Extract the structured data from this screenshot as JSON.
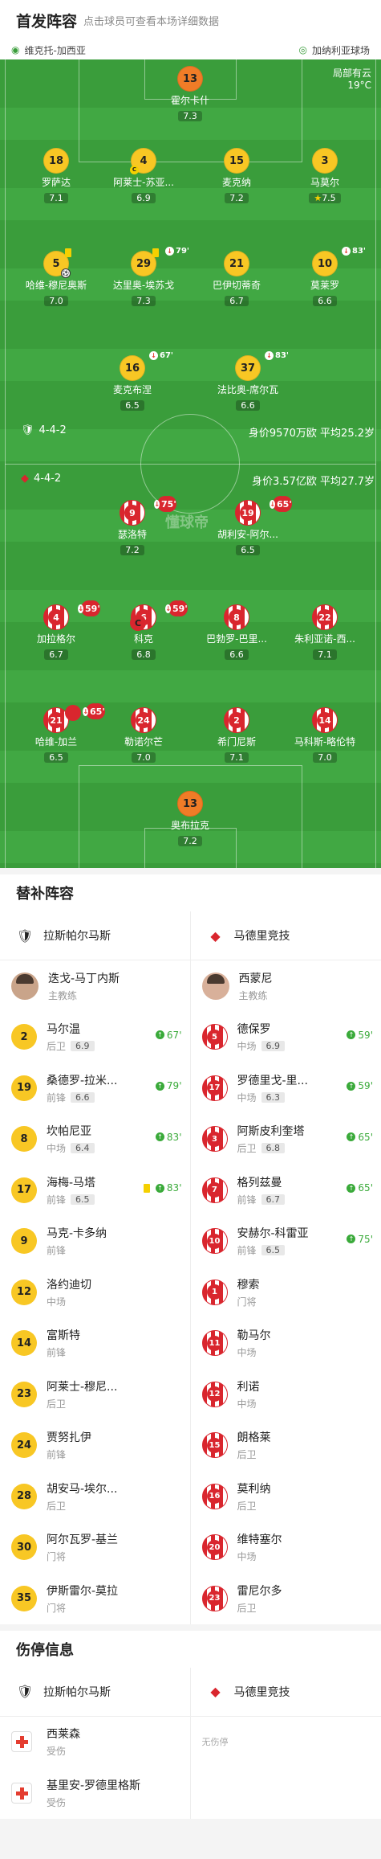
{
  "header": {
    "title": "首发阵容",
    "subtitle": "点击球员可查看本场详细数据"
  },
  "venue": {
    "left": "维克托-加西亚",
    "right": "加纳利亚球场"
  },
  "weather": {
    "line1": "局部有云",
    "line2": "19°C"
  },
  "watermark": "懂球帝",
  "home_team": {
    "formation": "4-4-2",
    "value": "身价9570万欧",
    "age": "平均25.2岁"
  },
  "away_team": {
    "formation": "4-4-2",
    "value": "身价3.57亿欧",
    "age": "平均27.7岁"
  },
  "home_players": [
    {
      "num": "13",
      "name": "霍尔卡什",
      "rating": "7.3"
    },
    {
      "num": "18",
      "name": "罗萨达",
      "rating": "7.1"
    },
    {
      "num": "4",
      "name": "阿莱士-苏亚...",
      "rating": "6.9"
    },
    {
      "num": "15",
      "name": "麦克纳",
      "rating": "7.2"
    },
    {
      "num": "3",
      "name": "马莫尔",
      "rating": "7.5"
    },
    {
      "num": "5",
      "name": "哈维-穆尼奥斯",
      "rating": "7.0"
    },
    {
      "num": "29",
      "name": "达里奥-埃苏戈",
      "rating": "7.3",
      "sub": "79'"
    },
    {
      "num": "21",
      "name": "巴伊切蒂奇",
      "rating": "6.7"
    },
    {
      "num": "10",
      "name": "莫莱罗",
      "rating": "6.6",
      "sub": "83'"
    },
    {
      "num": "16",
      "name": "麦克布涅",
      "rating": "6.5",
      "sub": "67'"
    },
    {
      "num": "37",
      "name": "法比奥-席尔瓦",
      "rating": "6.6",
      "sub": "83'"
    }
  ],
  "away_players": [
    {
      "num": "9",
      "name": "瑟洛特",
      "rating": "7.2",
      "sub": "75'"
    },
    {
      "num": "19",
      "name": "胡利安-阿尔...",
      "rating": "6.5",
      "sub": "65'"
    },
    {
      "num": "4",
      "name": "加拉格尔",
      "rating": "6.7",
      "sub": "59'"
    },
    {
      "num": "6",
      "name": "科克",
      "rating": "6.8",
      "sub": "59'"
    },
    {
      "num": "8",
      "name": "巴勃罗-巴里...",
      "rating": "6.6"
    },
    {
      "num": "22",
      "name": "朱利亚诺-西...",
      "rating": "7.1"
    },
    {
      "num": "21",
      "name": "哈维-加兰",
      "rating": "6.5",
      "sub": "65'"
    },
    {
      "num": "24",
      "name": "勒诺尔芒",
      "rating": "7.0"
    },
    {
      "num": "2",
      "name": "希门尼斯",
      "rating": "7.1"
    },
    {
      "num": "14",
      "name": "马科斯-略伦特",
      "rating": "7.0"
    },
    {
      "num": "13",
      "name": "奥布拉克",
      "rating": "7.2"
    }
  ],
  "subs_title": "替补阵容",
  "home_name": "拉斯帕尔马斯",
  "away_name": "马德里竞技",
  "home_coach": {
    "name": "迭戈-马丁内斯",
    "role": "主教练"
  },
  "away_coach": {
    "name": "西蒙尼",
    "role": "主教练"
  },
  "home_subs": [
    {
      "num": "2",
      "name": "马尔温",
      "pos": "后卫",
      "rating": "6.9",
      "min": "67'"
    },
    {
      "num": "19",
      "name": "桑德罗-拉米...",
      "pos": "前锋",
      "rating": "6.6",
      "min": "79'"
    },
    {
      "num": "8",
      "name": "坎帕尼亚",
      "pos": "中场",
      "rating": "6.4",
      "min": "83'"
    },
    {
      "num": "17",
      "name": "海梅-马塔",
      "pos": "前锋",
      "rating": "6.5",
      "min": "83'",
      "yellow": true
    },
    {
      "num": "9",
      "name": "马克-卡多纳",
      "pos": "前锋"
    },
    {
      "num": "12",
      "name": "洛约迪切",
      "pos": "中场"
    },
    {
      "num": "14",
      "name": "富斯特",
      "pos": "前锋"
    },
    {
      "num": "23",
      "name": "阿莱士-穆尼...",
      "pos": "后卫"
    },
    {
      "num": "24",
      "name": "贾努扎伊",
      "pos": "前锋"
    },
    {
      "num": "28",
      "name": "胡安马-埃尔...",
      "pos": "后卫"
    },
    {
      "num": "30",
      "name": "阿尔瓦罗-基兰",
      "pos": "门将"
    },
    {
      "num": "35",
      "name": "伊斯雷尔-莫拉",
      "pos": "门将"
    }
  ],
  "away_subs": [
    {
      "num": "5",
      "name": "德保罗",
      "pos": "中场",
      "rating": "6.9",
      "min": "59'"
    },
    {
      "num": "17",
      "name": "罗德里戈-里...",
      "pos": "中场",
      "rating": "6.3",
      "min": "59'"
    },
    {
      "num": "3",
      "name": "阿斯皮利奎塔",
      "pos": "后卫",
      "rating": "6.8",
      "min": "65'"
    },
    {
      "num": "7",
      "name": "格列兹曼",
      "pos": "前锋",
      "rating": "6.7",
      "min": "65'"
    },
    {
      "num": "10",
      "name": "安赫尔-科雷亚",
      "pos": "前锋",
      "rating": "6.5",
      "min": "75'"
    },
    {
      "num": "1",
      "name": "穆索",
      "pos": "门将"
    },
    {
      "num": "11",
      "name": "勒马尔",
      "pos": "中场"
    },
    {
      "num": "12",
      "name": "利诺",
      "pos": "中场"
    },
    {
      "num": "15",
      "name": "朗格莱",
      "pos": "后卫"
    },
    {
      "num": "16",
      "name": "莫利纳",
      "pos": "后卫"
    },
    {
      "num": "20",
      "name": "维特塞尔",
      "pos": "中场"
    },
    {
      "num": "23",
      "name": "雷尼尔多",
      "pos": "后卫"
    }
  ],
  "injury_title": "伤停信息",
  "injuries_home": [
    {
      "name": "西莱森",
      "status": "受伤"
    },
    {
      "name": "基里安-罗德里格斯",
      "status": "受伤"
    }
  ],
  "injuries_away_empty": "无伤停",
  "colors": {
    "pitch": "#3a9d3b",
    "home": "#f8c724",
    "away": "#d9262e",
    "gk": "#f07c27"
  }
}
